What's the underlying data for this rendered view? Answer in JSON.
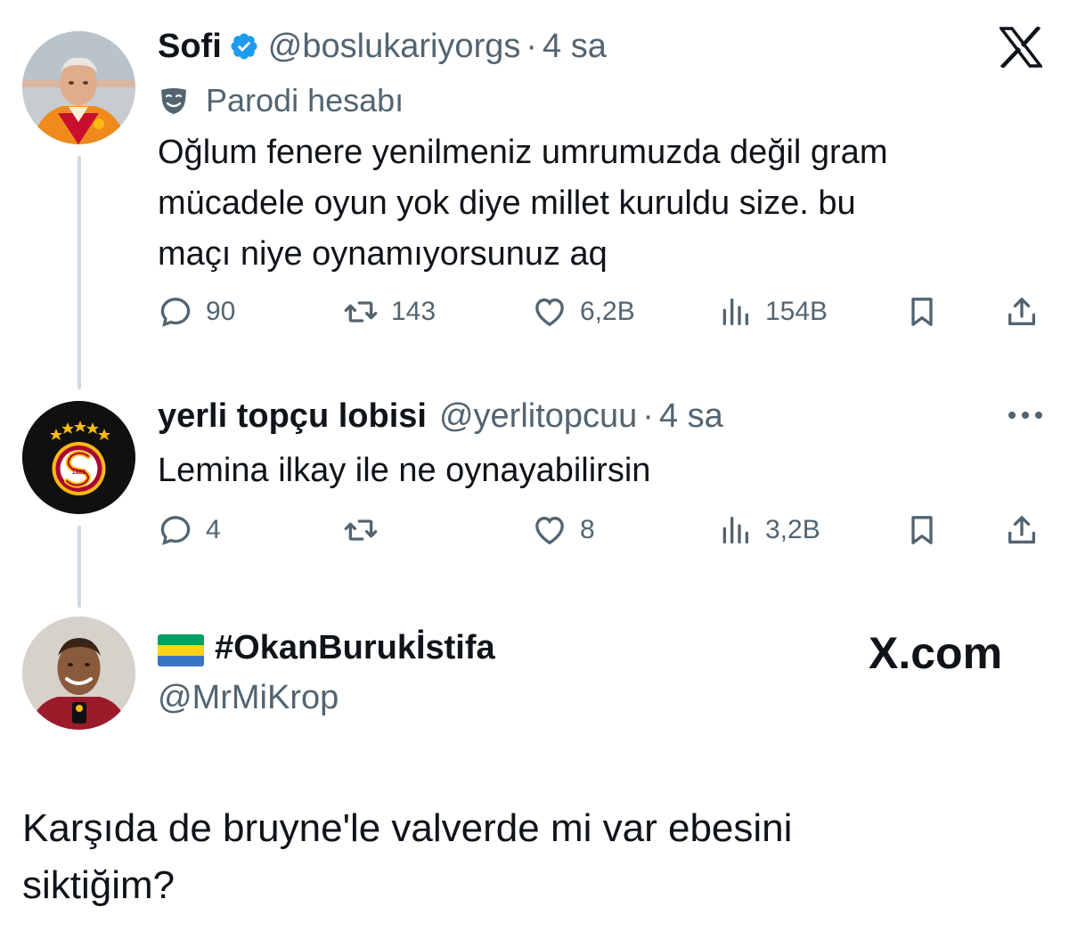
{
  "tweet1": {
    "name": "Sofi",
    "handle": "@boslukariyorgs",
    "separator": "·",
    "time": "4 sa",
    "label": "Parodi hesabı",
    "text": "Oğlum fenere yenilmeniz umrumuzda değil gram\nmücadele oyun yok diye millet kuruldu size. bu\nmaçı niye oynamıyorsunuz aq",
    "stats": {
      "replies": "90",
      "retweets": "143",
      "likes": "6,2B",
      "views": "154B"
    }
  },
  "tweet2": {
    "name": "yerli topçu lobisi",
    "handle": "@yerlitopcuu",
    "separator": "·",
    "time": "4 sa",
    "text": "Lemina ilkay ile ne oynayabilirsin",
    "crest_year": "1905",
    "stats": {
      "replies": "4",
      "retweets": "",
      "likes": "8",
      "views": "3,2B"
    }
  },
  "tweet3": {
    "name": "#OkanBurukİstifa",
    "handle": "@MrMiKrop",
    "site": "X.com",
    "text": "Karşıda de bruyne'le valverde mi var ebesini\nsiktiğim?"
  },
  "icons": {
    "top_right": "x-logo-icon",
    "more": "more-dots-icon",
    "reply": "reply-icon",
    "retweet": "retweet-icon",
    "like": "heart-icon",
    "views": "views-icon",
    "bookmark": "bookmark-icon",
    "share": "share-icon",
    "verified": "verified-badge-icon",
    "parody": "parody-mask-icon",
    "flag": "gabon-flag-icon"
  },
  "colors": {
    "text": "#0f1419",
    "muted": "#536471",
    "verified": "#1d9bf0",
    "thread_line": "#cfd9de",
    "galatasaray_red": "#a90432",
    "galatasaray_yellow": "#fdb912"
  }
}
